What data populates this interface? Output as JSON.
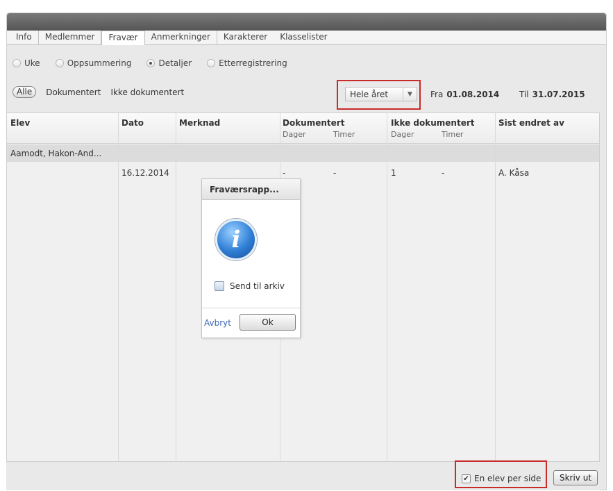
{
  "tabs": [
    {
      "label": "Info"
    },
    {
      "label": "Medlemmer"
    },
    {
      "label": "Fravær"
    },
    {
      "label": "Anmerkninger"
    },
    {
      "label": "Karakterer"
    },
    {
      "label": "Klasselister"
    }
  ],
  "view_options": [
    {
      "label": "Uke",
      "selected": false
    },
    {
      "label": "Oppsummering",
      "selected": false
    },
    {
      "label": "Detaljer",
      "selected": true
    },
    {
      "label": "Etterregistrering",
      "selected": false
    }
  ],
  "filters": {
    "all": "Alle",
    "documented": "Dokumentert",
    "undocumented": "Ikke dokumentert"
  },
  "period": {
    "select_value": "Hele året",
    "from_label": "Fra",
    "from_date": "01.08.2014",
    "to_label": "Til",
    "to_date": "31.07.2015"
  },
  "table": {
    "headers": {
      "student": "Elev",
      "date": "Dato",
      "note": "Merknad",
      "documented": "Dokumentert",
      "undocumented": "Ikke dokumentert",
      "days": "Dager",
      "hours": "Timer",
      "changed_by": "Sist endret av"
    },
    "group_student": "Aamodt, Hakon-And...",
    "row": {
      "date": "16.12.2014",
      "doc_days": "-",
      "doc_hours": "-",
      "undoc_days": "1",
      "undoc_hours": "-",
      "changed_by": "A. Kåsa"
    }
  },
  "dialog": {
    "title": "Fraværsrapp...",
    "icon": "info-icon",
    "checkbox_label": "Send til arkiv",
    "checkbox_checked": false,
    "cancel": "Avbryt",
    "ok": "Ok"
  },
  "footer": {
    "one_per_page": "En elev per side",
    "one_per_page_checked": true,
    "print": "Skriv ut"
  },
  "colors": {
    "highlight": "#c92a2a",
    "link": "#3b66b5"
  }
}
